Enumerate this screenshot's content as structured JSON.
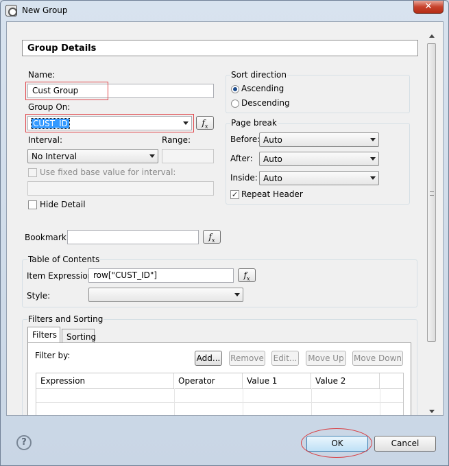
{
  "window": {
    "title": "New Group",
    "close_label": "✕"
  },
  "header": {
    "title": "Group Details"
  },
  "name": {
    "label": "Name:",
    "value": "Cust Group"
  },
  "group_on": {
    "label": "Group On:",
    "value": "CUST_ID"
  },
  "interval": {
    "label": "Interval:",
    "value": "No Interval"
  },
  "range": {
    "label": "Range:",
    "value": ""
  },
  "fixed_base": {
    "label": "Use fixed base value for interval:",
    "checked": false,
    "value": ""
  },
  "hide_detail": {
    "label": "Hide Detail",
    "checked": false
  },
  "sort_direction": {
    "label": "Sort direction",
    "options": [
      {
        "label": "Ascending",
        "selected": true
      },
      {
        "label": "Descending",
        "selected": false
      }
    ]
  },
  "page_break": {
    "label": "Page break",
    "before": {
      "label": "Before:",
      "value": "Auto"
    },
    "after": {
      "label": "After:",
      "value": "Auto"
    },
    "inside": {
      "label": "Inside:",
      "value": "Auto"
    },
    "repeat_header": {
      "label": "Repeat Header",
      "checked": true
    }
  },
  "bookmark": {
    "label": "Bookmark:",
    "value": ""
  },
  "toc": {
    "label": "Table of Contents",
    "item_expression": {
      "label": "Item Expression:",
      "value": "row[\"CUST_ID\"]"
    },
    "style": {
      "label": "Style:",
      "value": ""
    }
  },
  "filters_sorting": {
    "label": "Filters and Sorting",
    "tabs": [
      "Filters",
      "Sorting"
    ],
    "filter_by_label": "Filter by:",
    "buttons": {
      "add": "Add...",
      "remove": "Remove",
      "edit": "Edit...",
      "move_up": "Move Up",
      "move_down": "Move Down"
    },
    "columns": [
      "Expression",
      "Operator",
      "Value 1",
      "Value 2"
    ]
  },
  "footer": {
    "help": "?",
    "ok": "OK",
    "cancel": "Cancel"
  },
  "fx_label": "f",
  "fx_sub": "x",
  "colors": {
    "selection": "#3399ff",
    "highlight_red": "#e0464b"
  }
}
